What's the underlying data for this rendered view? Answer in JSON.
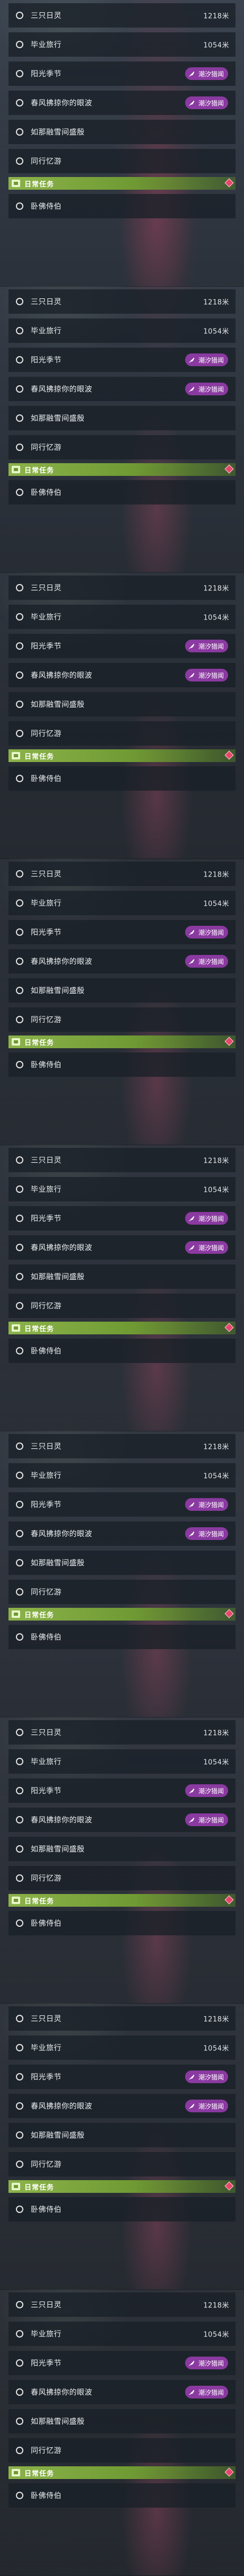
{
  "panels_count": 9,
  "tasks": [
    {
      "name": "三只日灵",
      "distance": "1218米",
      "event": null
    },
    {
      "name": "毕业旅行",
      "distance": "1054米",
      "event": null
    },
    {
      "name": "阳光季节",
      "distance": null,
      "event": "潮汐猎闻"
    },
    {
      "name": "春风拂掠你的眼波",
      "distance": null,
      "event": "潮汐猎闻"
    },
    {
      "name": "如那融雪间盛殷",
      "distance": null,
      "event": null
    },
    {
      "name": "同行忆游",
      "distance": null,
      "event": null
    }
  ],
  "daily_section": {
    "title": "日常任务",
    "tasks": [
      {
        "name": "卧佛侍伯"
      }
    ]
  },
  "colors": {
    "event_tag": "#8a3aa0",
    "daily_header": "#8cb34a",
    "alert_diamond": "#e5486b"
  },
  "icons": {
    "radio": "radio-circle-icon",
    "event": "feather-icon",
    "daily": "task-board-icon",
    "alert": "alert-diamond-icon"
  }
}
